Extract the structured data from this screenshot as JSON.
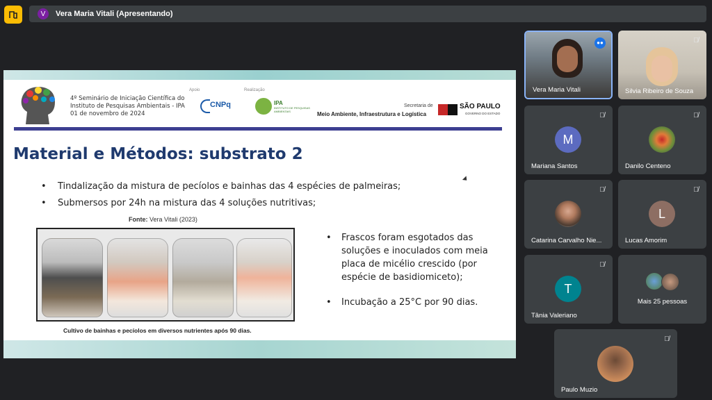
{
  "meeting": {
    "presenter_initial": "V",
    "presenter_title": "Vera Maria Vitali (Apresentando)"
  },
  "slide": {
    "seminar_lines": [
      "4º Seminário de Iniciação Científica do",
      "Instituto de Pesquisas Ambientais - IPA",
      "01 de novembro de 2024"
    ],
    "apoio_label": "Apoio",
    "cnpq_label": "CNPq",
    "realizacao_label": "Realização",
    "ipa_label": "IPA",
    "ipa_sub": "INSTITUTO DE PESQUISAS AMBIENTAIS",
    "secretaria_label": "Secretaria de",
    "meio_ambiente": "Meio Ambiente, Infraestrutura e Logística",
    "sp_label": "SÃO PAULO",
    "sp_sub": "GOVERNO DO ESTADO",
    "title": "Material e Métodos: substrato 2",
    "bullets": [
      "Tindalização da mistura de pecíolos e bainhas das 4 espécies de palmeiras;",
      "Submersos por 24h na mistura das 4 soluções nutritivas;"
    ],
    "fonte_label": "Fonte:",
    "fonte_value": "Vera Vitali (2023)",
    "caption": "Cultivo de bainhas e pecíolos em diversos nutrientes após 90 dias.",
    "right_bullets": [
      "Frascos foram esgotados das soluções e inoculados com meia placa de micélio crescido (por espécie de basidiomiceto);",
      "Incubação a 25°C por 90 dias."
    ]
  },
  "participants": [
    {
      "name": "Vera Maria Vitali",
      "speaking": true
    },
    {
      "name": "Silvia Ribeiro de Souza"
    },
    {
      "name": "Mariana Santos",
      "initial": "M",
      "color": "#5c6bc0"
    },
    {
      "name": "Danilo Centeno"
    },
    {
      "name": "Catarina Carvalho Nie..."
    },
    {
      "name": "Lucas Amorim",
      "initial": "L",
      "color": "#8d6e63"
    },
    {
      "name": "Tânia Valeriano",
      "initial": "T",
      "color": "#00838f"
    },
    {
      "name": "Mais 25 pessoas"
    },
    {
      "name": "Paulo Muzio"
    }
  ],
  "colors": {
    "accent": "#1a73e8",
    "slide_title": "#1f3a6e",
    "slide_divider": "#3d3f91",
    "app_icon": "#fbbc04"
  }
}
